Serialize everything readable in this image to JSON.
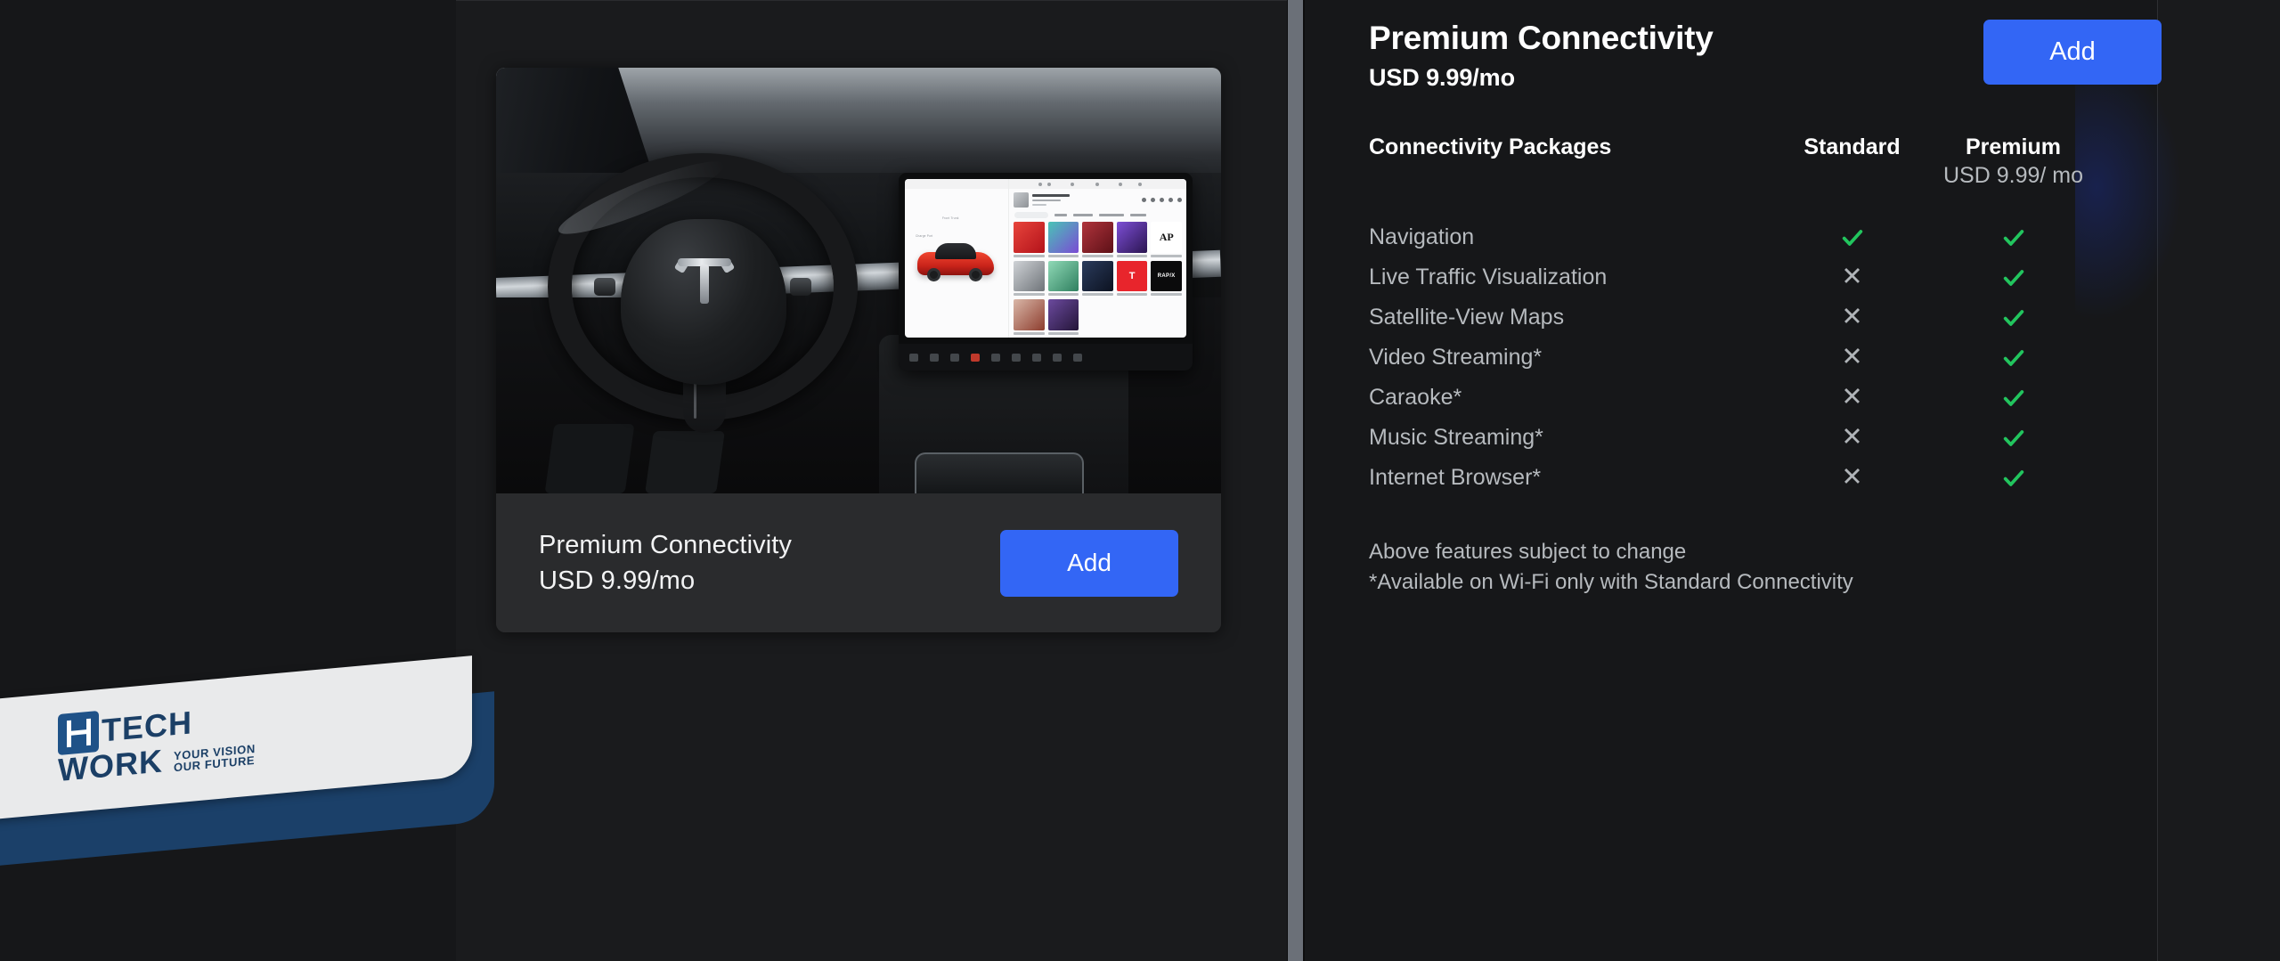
{
  "product_card": {
    "name": "product-card",
    "title": "Premium Connectivity",
    "price": "USD 9.99/mo",
    "add_label": "Add",
    "image_alt": "tesla-model-3-interior-dashboard-touchscreen"
  },
  "detail": {
    "title": "Premium Connectivity",
    "price": "USD 9.99/mo",
    "add_label": "Add",
    "table": {
      "header_feature": "Connectivity Packages",
      "header_standard": "Standard",
      "header_premium": "Premium",
      "header_premium_sub": "USD 9.99/ mo",
      "rows": [
        {
          "feature": "Navigation",
          "standard": "check",
          "premium": "check"
        },
        {
          "feature": "Live Traffic Visualization",
          "standard": "x",
          "premium": "check"
        },
        {
          "feature": "Satellite-View Maps",
          "standard": "x",
          "premium": "check"
        },
        {
          "feature": "Video Streaming*",
          "standard": "x",
          "premium": "check"
        },
        {
          "feature": "Caraoke*",
          "standard": "x",
          "premium": "check"
        },
        {
          "feature": "Music Streaming*",
          "standard": "x",
          "premium": "check"
        },
        {
          "feature": "Internet Browser*",
          "standard": "x",
          "premium": "check"
        }
      ]
    },
    "notes": [
      "Above features subject to change",
      "*Available on Wi-Fi only with Standard Connectivity"
    ]
  },
  "watermark": {
    "hi": "HI",
    "tech": "TECH",
    "work": "WORK",
    "tagline_1": "YOUR VISION",
    "tagline_2": "OUR FUTURE"
  },
  "colors": {
    "accent_blue": "#3366f5",
    "check_green": "#22c55e",
    "x_gray": "#b0b4b8",
    "panel_bg": "#161719",
    "card_bg": "#2a2b2d",
    "watermark_blue": "#1b3f66"
  }
}
